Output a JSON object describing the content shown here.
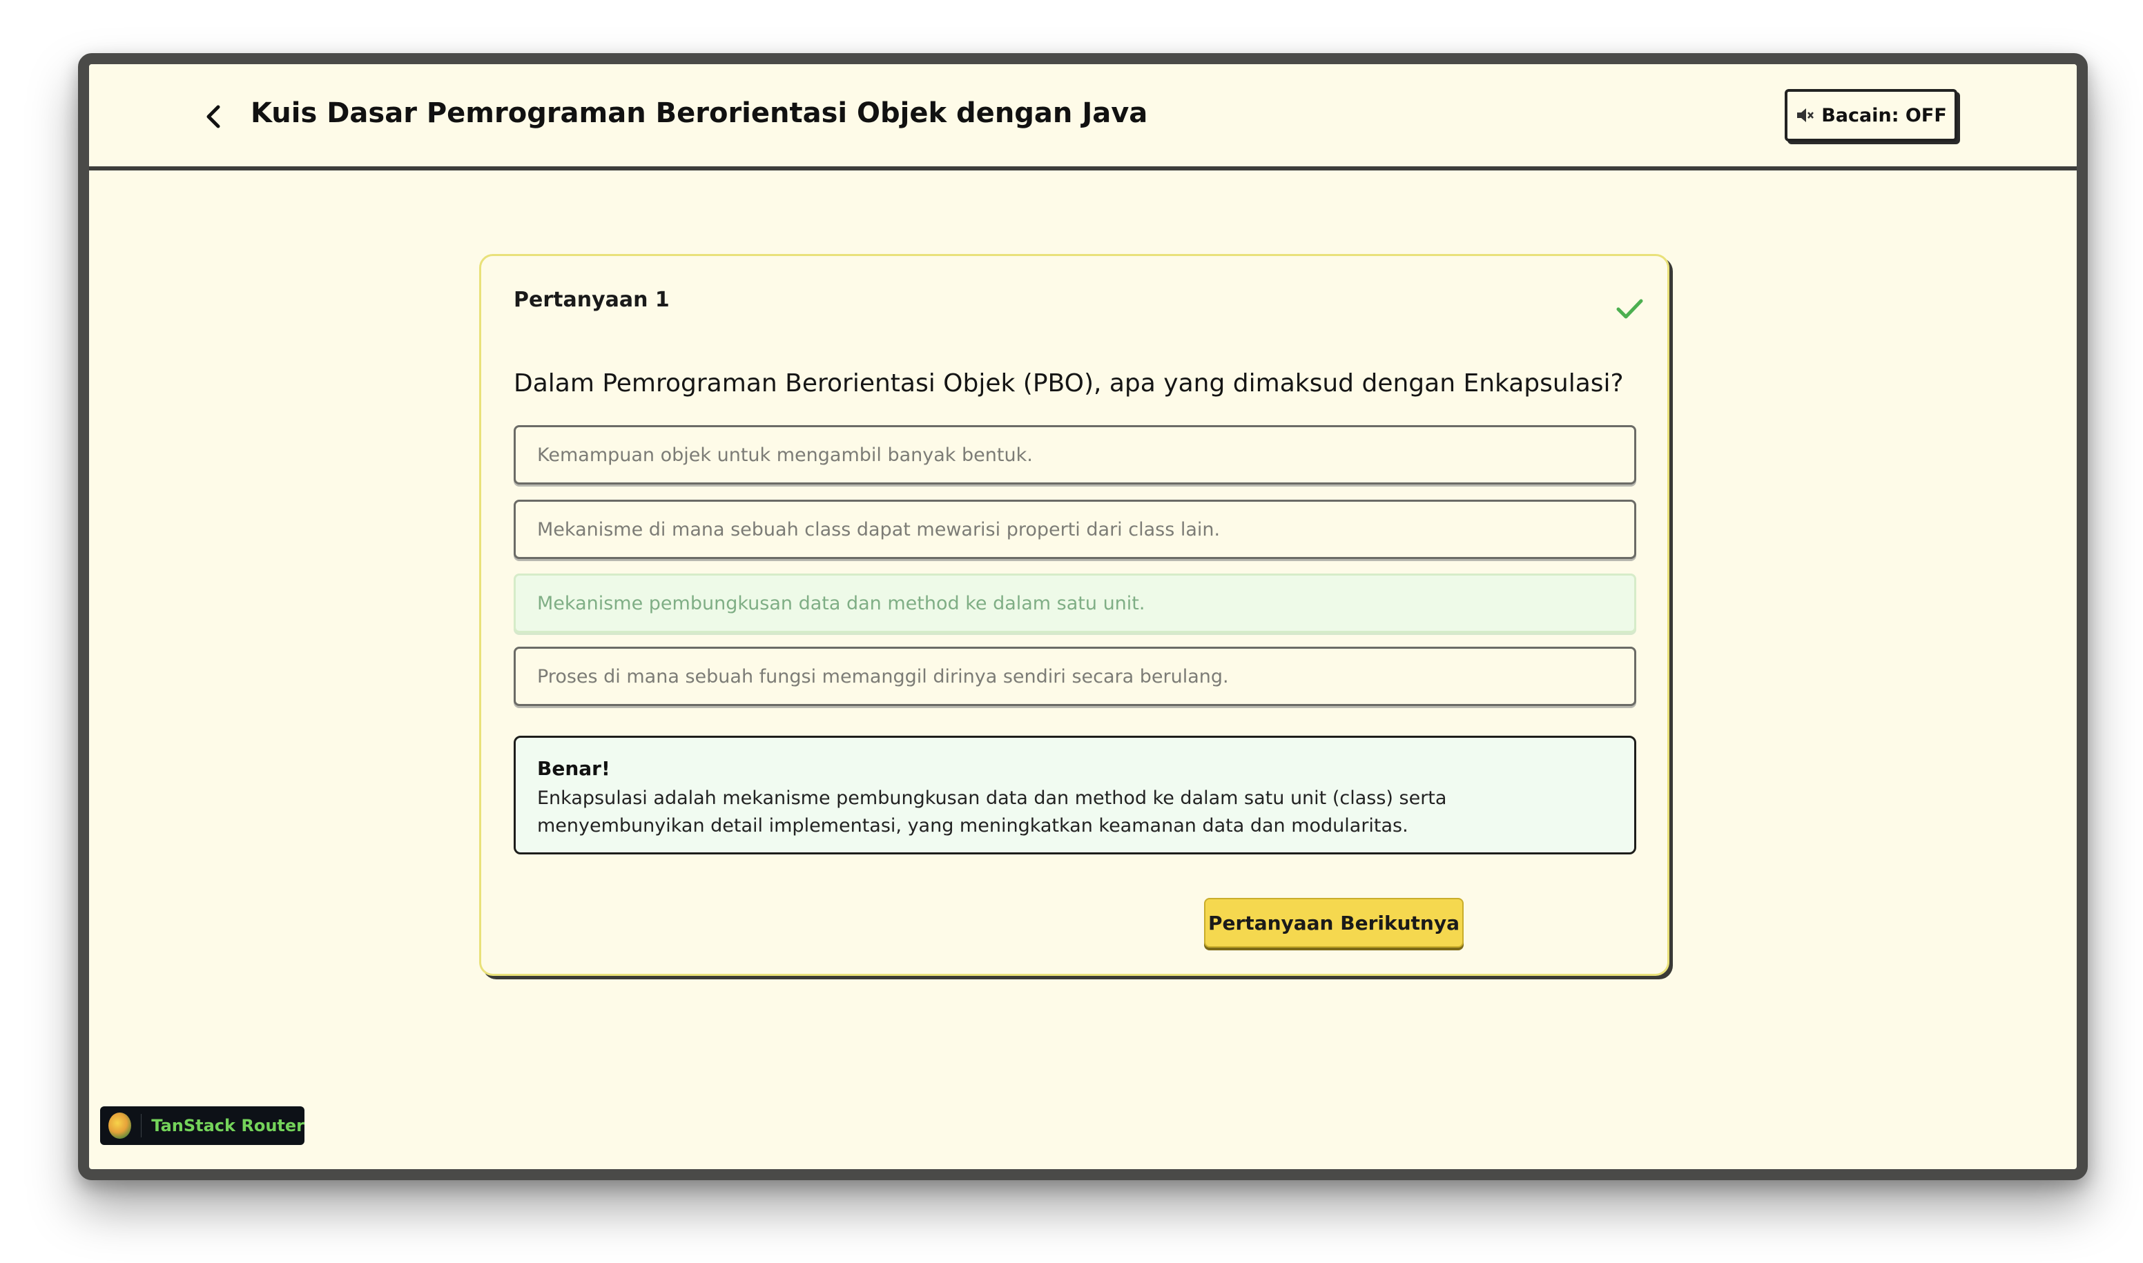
{
  "header": {
    "title": "Kuis Dasar Pemrograman Berorientasi Objek dengan Java",
    "reader_button": "Bacain: OFF",
    "reader_icon": "speaker-muted-icon"
  },
  "quiz": {
    "question_label": "Pertanyaan 1",
    "question_text": "Dalam Pemrograman Berorientasi Objek (PBO), apa yang dimaksud dengan Enkapsulasi?",
    "options": [
      {
        "text": "Kemampuan objek untuk mengambil banyak bentuk.",
        "state": "default"
      },
      {
        "text": "Mekanisme di mana sebuah class dapat mewarisi properti dari class lain.",
        "state": "default"
      },
      {
        "text": "Mekanisme pembungkusan data dan method ke dalam satu unit.",
        "state": "correct"
      },
      {
        "text": "Proses di mana sebuah fungsi memanggil dirinya sendiri secara berulang.",
        "state": "default"
      }
    ],
    "feedback": {
      "title": "Benar!",
      "text": "Enkapsulasi adalah mekanisme pembungkusan data dan method ke dalam satu unit (class) serta menyembunyikan detail implementasi, yang meningkatkan keamanan data dan modularitas."
    },
    "next_button": "Pertanyaan Berikutnya"
  },
  "devtools": {
    "label": "TanStack Router"
  },
  "colors": {
    "background": "#fefbe8",
    "accent_yellow": "#f5d84f",
    "correct_green": "#4caf50",
    "correct_bg": "#eefae8",
    "frame": "#4a4a48"
  }
}
